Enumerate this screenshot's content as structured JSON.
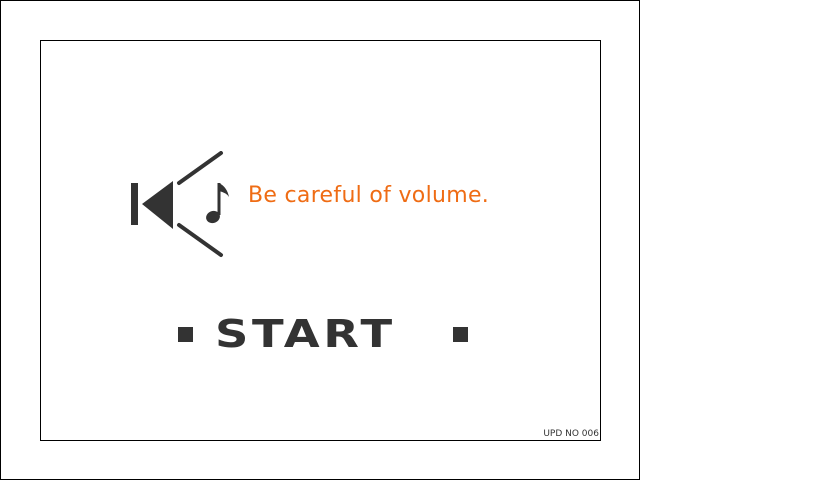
{
  "screen": {
    "warning_text": "Be careful of volume.",
    "start_label": "START",
    "version_label": "UPD NO 006"
  },
  "icons": {
    "speaker": "speaker-volume-icon",
    "music_note": "music-note-icon",
    "bullet": "square-bullet-icon"
  },
  "colors": {
    "warning_text": "#ef6c14",
    "icon_and_text": "#333333",
    "background": "#ffffff",
    "border": "#000000"
  }
}
